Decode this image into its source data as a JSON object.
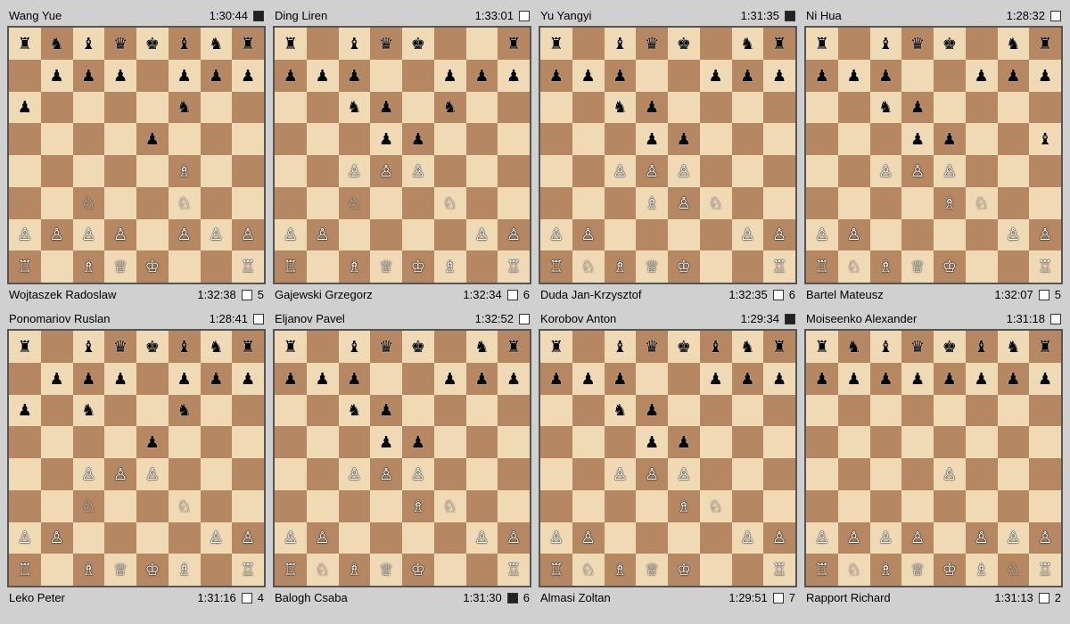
{
  "games": [
    {
      "id": "game1",
      "white": "Wang Yue",
      "white_time": "1:30:44",
      "white_color": "black",
      "black": "Wojtaszek Radoslaw",
      "black_time": "1:32:38",
      "black_color": "white",
      "moves": "5",
      "board": [
        "rnbqkbnr",
        ".ppp.ppp",
        "p....n..",
        "....p...",
        ".....B..",
        "..N..N..",
        "PPPP.PPP",
        "R.BQK..R"
      ]
    },
    {
      "id": "game2",
      "white": "Ding Liren",
      "white_time": "1:33:01",
      "white_color": "white",
      "black": "Gajewski Grzegorz",
      "black_time": "1:32:34",
      "black_color": "white",
      "moves": "6",
      "board": [
        "r.bqk..r",
        "ppp..ppp",
        "..np.n..",
        "...pp...",
        "..PPP...",
        "..N..N..",
        "PP....PP",
        "R.BQKB.R"
      ]
    },
    {
      "id": "game3",
      "white": "Yu Yangyi",
      "white_time": "1:31:35",
      "white_color": "black",
      "black": "Duda Jan-Krzysztof",
      "black_time": "1:32:35",
      "black_color": "white",
      "moves": "6",
      "board": [
        "r.bqk.nr",
        "ppp..ppp",
        "..np....",
        "...pp...",
        "..PPP...",
        "...BPN..",
        "PP....PP",
        "RNBQK..R"
      ]
    },
    {
      "id": "game4",
      "white": "Ni Hua",
      "white_time": "1:28:32",
      "white_color": "white",
      "black": "Bartel Mateusz",
      "black_time": "1:32:07",
      "black_color": "white",
      "moves": "5",
      "board": [
        "r.bqk.nr",
        "ppp..ppp",
        "..np....",
        "...pp..b",
        "..PPP...",
        "....BN..",
        "PP....PP",
        "RNBQK..R"
      ]
    },
    {
      "id": "game5",
      "white": "Ponomariov Ruslan",
      "white_time": "1:28:41",
      "white_color": "white",
      "black": "Leko Peter",
      "black_time": "1:31:16",
      "black_color": "white",
      "moves": "4",
      "board": [
        "r.bqkbnr",
        ".ppp.ppp",
        "p.n..n..",
        "....p...",
        "..PPP...",
        "..N..N..",
        "PP....PP",
        "R.BQKB.R"
      ]
    },
    {
      "id": "game6",
      "white": "Eljanov Pavel",
      "white_time": "1:32:52",
      "white_color": "white",
      "black": "Balogh Csaba",
      "black_time": "1:31:30",
      "black_color": "black",
      "moves": "6",
      "board": [
        "r.bqk.nr",
        "ppp..ppp",
        "..np....",
        "...pp...",
        "..PPP...",
        "....BN..",
        "PP....PP",
        "RNBQK..R"
      ]
    },
    {
      "id": "game7",
      "white": "Korobov Anton",
      "white_time": "1:29:34",
      "white_color": "black",
      "black": "Almasi Zoltan",
      "black_time": "1:29:51",
      "black_color": "white",
      "moves": "7",
      "board": [
        "r.bqkbnr",
        "ppp..ppp",
        "..np....",
        "...pp...",
        "..PPP...",
        "....BN..",
        "PP....PP",
        "RNBQK..R"
      ]
    },
    {
      "id": "game8",
      "white": "Moiseenko Alexander",
      "white_time": "1:31:18",
      "white_color": "white",
      "black": "Rapport Richard",
      "black_time": "1:31:13",
      "black_color": "white",
      "moves": "2",
      "board": [
        "rnbqkbnr",
        "pppppppp",
        "........",
        "........",
        "....P...",
        "........",
        "PPPP.PPP",
        "RNBQKBNR"
      ]
    }
  ],
  "pieces": {
    "r": "♜",
    "n": "♞",
    "b": "♝",
    "q": "♛",
    "k": "♚",
    "p": "♟",
    "R": "♖",
    "N": "♘",
    "B": "♗",
    "Q": "♕",
    "K": "♔",
    "P": "♙"
  }
}
